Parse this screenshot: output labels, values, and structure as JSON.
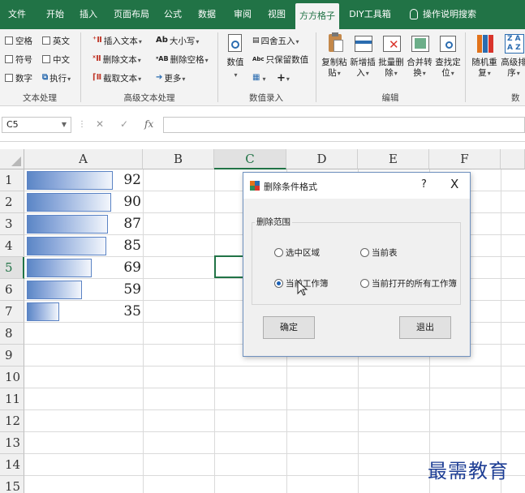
{
  "tabs": [
    {
      "label": "文件"
    },
    {
      "label": "开始"
    },
    {
      "label": "插入"
    },
    {
      "label": "页面布局"
    },
    {
      "label": "公式"
    },
    {
      "label": "数据"
    },
    {
      "label": "审阅"
    },
    {
      "label": "视图"
    },
    {
      "label": "方方格子",
      "active": true
    },
    {
      "label": "DIY工具箱"
    },
    {
      "label": "操作说明搜索"
    }
  ],
  "ribbon": {
    "text_processing": {
      "label": "文本处理",
      "checks": [
        "空格",
        "英文",
        "符号",
        "中文",
        "数字",
        "执行"
      ]
    },
    "advanced_text": {
      "label": "高级文本处理",
      "items": [
        "插入文本",
        "删除文本",
        "截取文本",
        "大小写",
        "删除空格",
        "更多"
      ]
    },
    "numeric_entry": {
      "label": "数值录入",
      "numeric": "数值",
      "round": "四舍五入",
      "keep_value": "只保留数值",
      "plus": "+"
    },
    "edit": {
      "label": "编辑",
      "buttons": [
        "复制粘贴",
        "新增插入",
        "批量删除",
        "合并转换",
        "查找定位"
      ],
      "buttons_line1": [
        "复制粘",
        "新增插",
        "批量删",
        "合并转",
        "查找定"
      ],
      "buttons_line2": [
        "贴",
        "入",
        "除",
        "换",
        "位"
      ]
    },
    "more": {
      "buttons_line1": [
        "随机重",
        "高级排"
      ],
      "buttons_line2": [
        "复",
        "序"
      ],
      "label_partial": "数"
    }
  },
  "formula_bar": {
    "name_box": "C5",
    "cancel": "✕",
    "confirm": "✓",
    "fx": "fx",
    "value": ""
  },
  "sheet": {
    "columns": [
      "A",
      "B",
      "C",
      "D",
      "E",
      "F"
    ],
    "selected_column": "C",
    "rows": [
      "1",
      "2",
      "3",
      "4",
      "5",
      "6",
      "7",
      "8",
      "9",
      "10",
      "11",
      "12",
      "13",
      "14",
      "15"
    ],
    "selected_row": "5",
    "selected_cell": "C5",
    "values": [
      92,
      90,
      87,
      85,
      69,
      59,
      35
    ],
    "data_bar_max": 92,
    "data_bar_color": "#5b86c6"
  },
  "dialog": {
    "title": "删除条件格式",
    "help": "?",
    "close": "X",
    "group_label": "删除范围",
    "options": [
      {
        "label": "选中区域",
        "checked": false
      },
      {
        "label": "当前表",
        "checked": false
      },
      {
        "label": "当前工作簿",
        "checked": true
      },
      {
        "label": "当前打开的所有工作簿",
        "checked": false
      }
    ],
    "ok": "确定",
    "exit": "退出"
  },
  "watermark": "最需教育",
  "colors": {
    "accent": "#217346",
    "dialog_border": "#6f91bf",
    "watermark": "#1f3f95"
  }
}
